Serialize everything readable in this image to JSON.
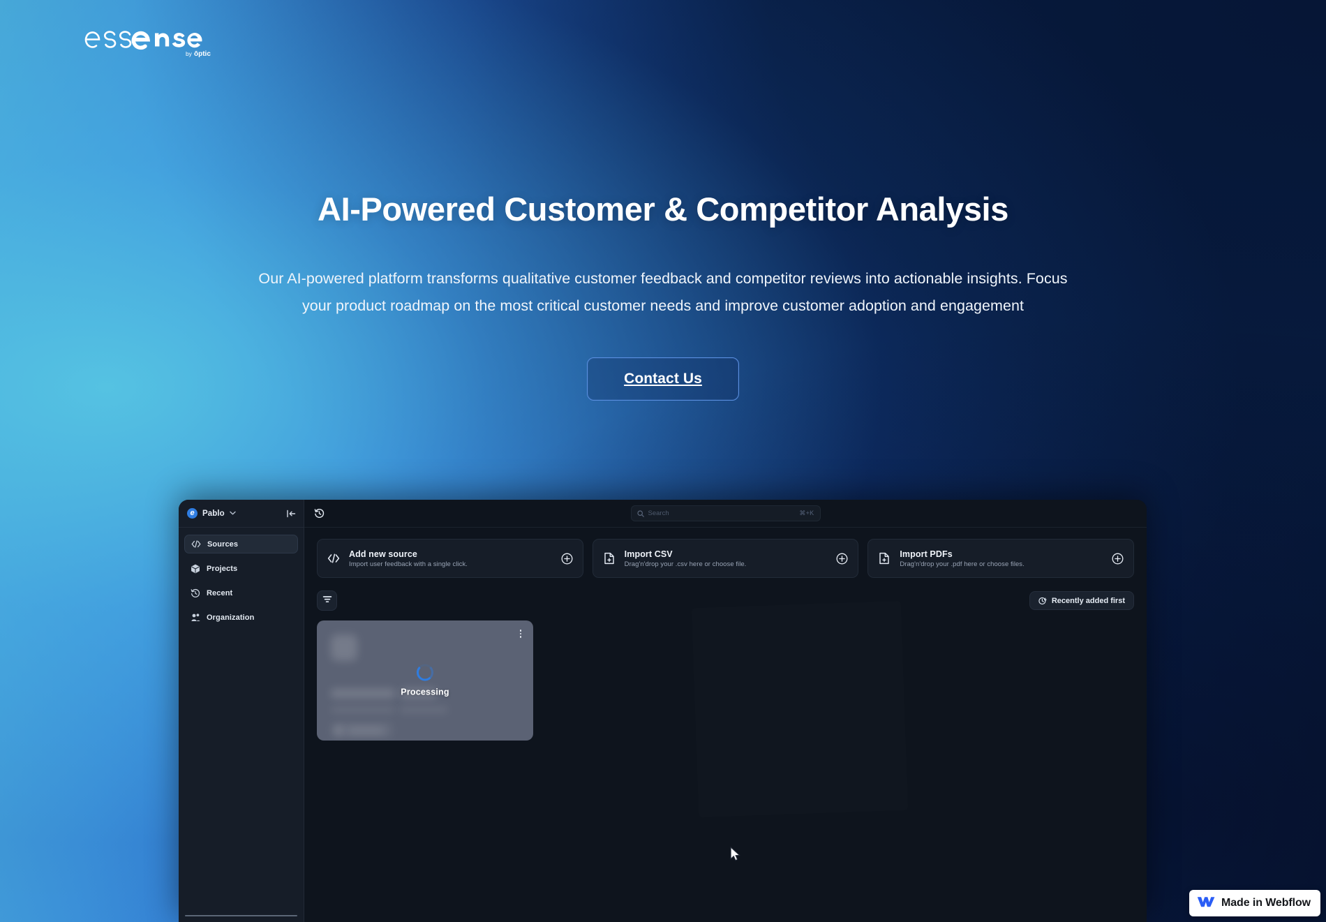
{
  "brand": {
    "logo_word": "essense",
    "logo_tagline": "by optic"
  },
  "hero": {
    "title": "AI-Powered Customer & Competitor Analysis",
    "subtitle": "Our AI-powered platform transforms qualitative customer feedback and competitor reviews into actionable insights. Focus your product roadmap on the most critical customer needs and improve customer adoption and engagement",
    "cta_label": "Contact Us"
  },
  "app": {
    "sidebar": {
      "logo_glyph": "e",
      "user": "Pablo",
      "caret": "⌄",
      "collapse_glyph": "|←",
      "items": [
        {
          "label": "Sources",
          "icon": "code-icon",
          "active": true
        },
        {
          "label": "Projects",
          "icon": "box-icon",
          "active": false
        },
        {
          "label": "Recent",
          "icon": "history-icon",
          "active": false
        },
        {
          "label": "Organization",
          "icon": "users-icon",
          "active": false
        }
      ]
    },
    "topbar": {
      "history_icon": "history-icon",
      "search_placeholder": "Search",
      "search_value": "",
      "search_shortcut": "⌘+K"
    },
    "cards": [
      {
        "icon": "code-icon",
        "title": "Add new source",
        "desc": "Import user feedback with a single click.",
        "action": "plus-circle-icon"
      },
      {
        "icon": "file-plus-icon",
        "title": "Import CSV",
        "desc": "Drag'n'drop your .csv here or choose file.",
        "action": "plus-circle-icon"
      },
      {
        "icon": "file-plus-icon",
        "title": "Import PDFs",
        "desc": "Drag'n'drop your .pdf here or choose files.",
        "action": "plus-circle-icon"
      }
    ],
    "toolbar": {
      "filter_icon": "filter-icon",
      "sort_icon": "clock-arrow-icon",
      "sort_label": "Recently added first"
    },
    "source_card": {
      "status_label": "Processing",
      "menu_icon": "kebab-menu-icon"
    }
  },
  "webflow_badge": {
    "label": "Made in Webflow",
    "logo": "webflow-logo-icon"
  },
  "colors": {
    "accent_blue": "#2f7de1",
    "cta_border": "#5a8fe0",
    "panel_bg": "#0e141d",
    "sidebar_bg": "#161d28",
    "gradient_left": "#4fb6dd",
    "gradient_right": "#08193d",
    "webflow_blue": "#2a5df5"
  }
}
